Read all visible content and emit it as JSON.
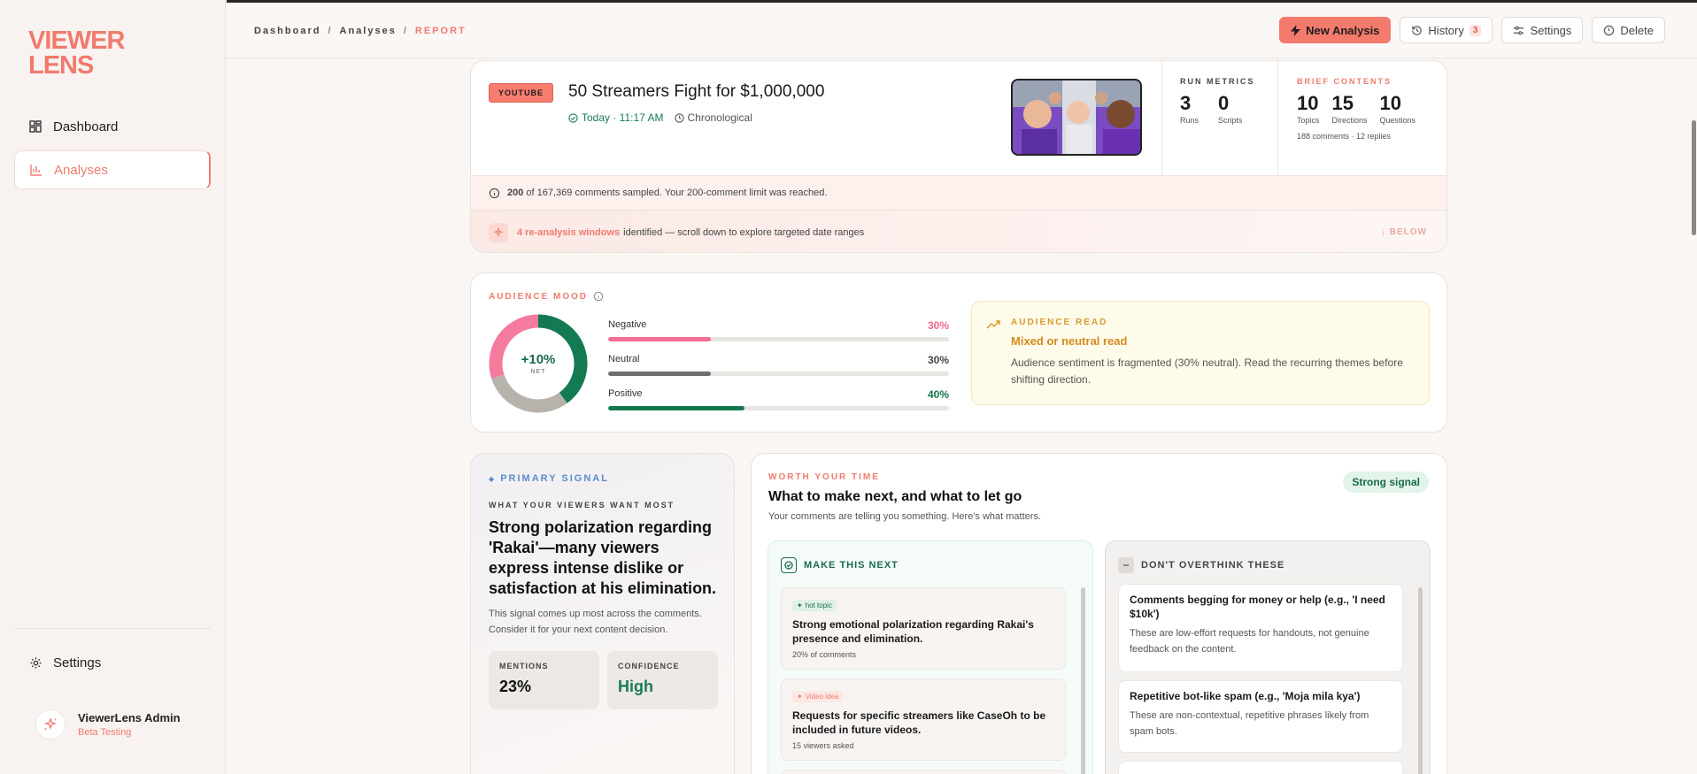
{
  "sidebar": {
    "logo_line1": "VIEWER",
    "logo_line2": "LENS",
    "nav": [
      {
        "label": "Dashboard",
        "icon": "grid-icon"
      },
      {
        "label": "Analyses",
        "icon": "bar-chart-icon"
      }
    ],
    "settings_label": "Settings",
    "user_name": "ViewerLens Admin",
    "user_role": "Beta Testing"
  },
  "topbar": {
    "breadcrumb": [
      "Dashboard",
      "Analyses",
      "REPORT"
    ],
    "new_analysis": "New Analysis",
    "history": "History",
    "history_count": "3",
    "settings": "Settings",
    "delete": "Delete"
  },
  "video": {
    "platform": "YOUTUBE",
    "title": "50 Streamers Fight for $1,000,000",
    "date": "Today · 11:17 AM",
    "order": "Chronological"
  },
  "run_metrics": {
    "label": "RUN METRICS",
    "runs": "3",
    "runs_label": "Runs",
    "scripts": "0",
    "scripts_label": "Scripts"
  },
  "brief_contents": {
    "label": "BRIEF CONTENTS",
    "topics": "10",
    "topics_label": "Topics",
    "directions": "15",
    "directions_label": "Directions",
    "questions": "10",
    "questions_label": "Questions",
    "note": "188 comments · 12 replies"
  },
  "sample": {
    "count": "200",
    "text": "of 167,369 comments sampled. Your 200-comment limit was reached."
  },
  "reanalysis": {
    "highlight": "4 re-analysis windows",
    "text": "identified — scroll down to explore targeted date ranges",
    "below": "↓ BELOW"
  },
  "mood": {
    "label": "AUDIENCE MOOD",
    "net": "+10%",
    "net_label": "NET",
    "bars": [
      {
        "label": "Negative",
        "pct": "30%",
        "value": 30,
        "color": "#f06f93"
      },
      {
        "label": "Neutral",
        "pct": "30%",
        "value": 30,
        "color": "#6f6f6f"
      },
      {
        "label": "Positive",
        "pct": "40%",
        "value": 40,
        "color": "#16774f"
      }
    ],
    "ring_colors": {
      "negative": "#f47a9e",
      "neutral": "#b8b2ad",
      "positive": "#137a52"
    },
    "read_label": "AUDIENCE READ",
    "read_title": "Mixed or neutral read",
    "read_body": "Audience sentiment is fragmented (30% neutral). Read the recurring themes before shifting direction."
  },
  "signal": {
    "label": "PRIMARY SIGNAL",
    "want_label": "WHAT YOUR VIEWERS WANT MOST",
    "title": "Strong polarization regarding 'Rakai'—many viewers express intense dislike or satisfaction at his elimination.",
    "body": "This signal comes up most across the comments. Consider it for your next content decision.",
    "mentions_label": "MENTIONS",
    "mentions": "23%",
    "confidence_label": "CONFIDENCE",
    "confidence": "High"
  },
  "worth": {
    "label": "WORTH YOUR TIME",
    "title": "What to make next, and what to let go",
    "subtitle": "Your comments are telling you something. Here's what matters.",
    "chip": "Strong signal",
    "make_label": "MAKE THIS NEXT",
    "make_items": [
      {
        "tag": "hot topic",
        "title": "Strong emotional polarization regarding Rakai's presence and elimination.",
        "sub": "20% of comments"
      },
      {
        "tag": "Video idea",
        "title": "Requests for specific streamers like CaseOh to be included in future videos.",
        "sub": "15 viewers asked"
      }
    ],
    "dont_label": "DON'T OVERTHINK THESE",
    "dont_items": [
      {
        "title": "Comments begging for money or help (e.g., 'I need $10k')",
        "body": "These are low-effort requests for handouts, not genuine feedback on the content."
      },
      {
        "title": "Repetitive bot-like spam (e.g., 'Moja mila kya')",
        "body": "These are non-contextual, repetitive phrases likely from spam bots."
      }
    ]
  }
}
